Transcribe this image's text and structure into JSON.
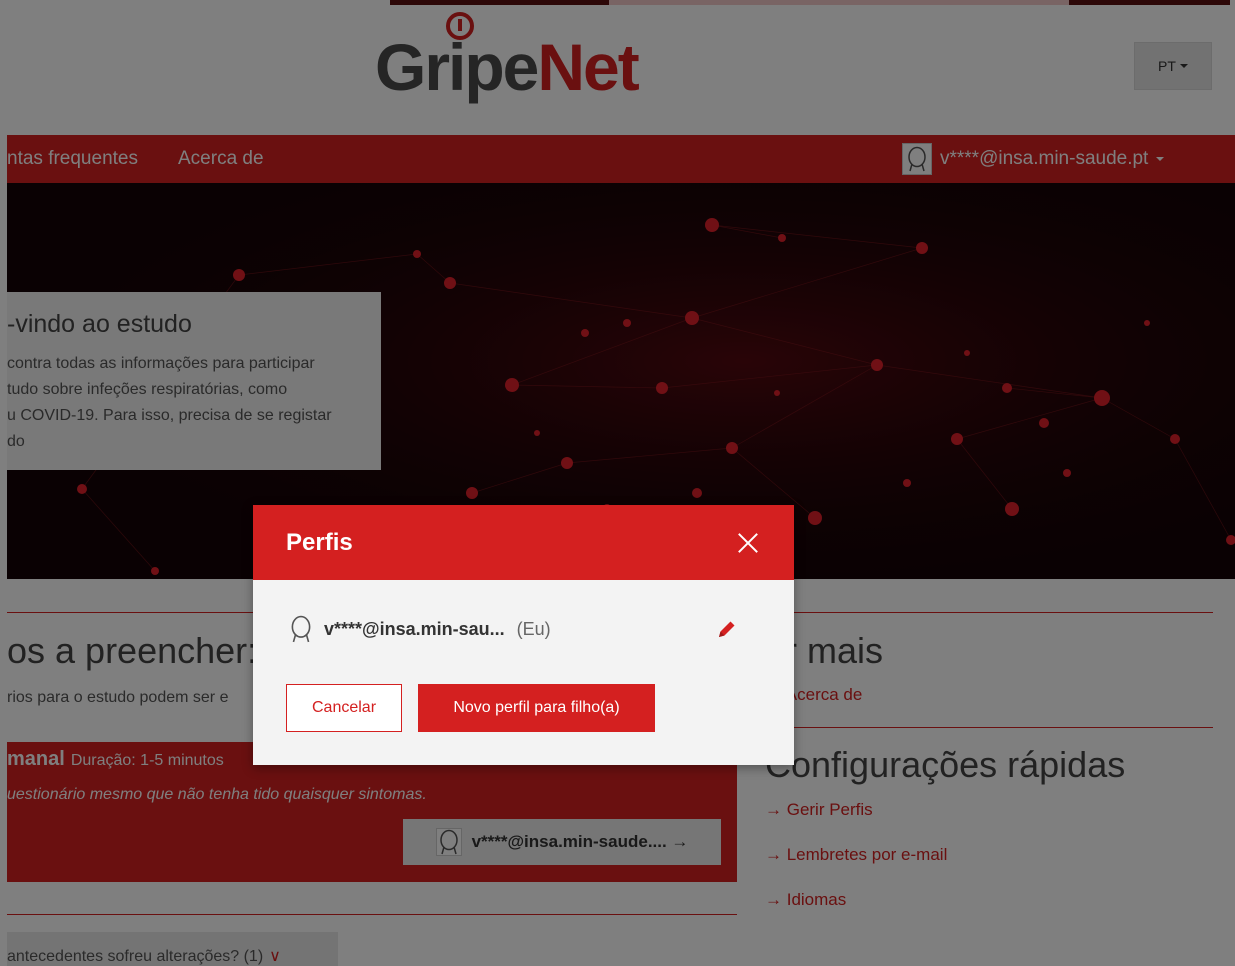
{
  "header": {
    "logo_part1": "Gri",
    "logo_part2": "pe",
    "logo_part3": "Net",
    "lang_label": "PT"
  },
  "nav": {
    "items": [
      {
        "label": "ntas frequentes"
      },
      {
        "label": "Acerca de"
      }
    ],
    "user_email": "v****@insa.min-saude.pt"
  },
  "hero": {
    "welcome_title": "-vindo ao estudo",
    "welcome_lines": [
      "contra todas as informações para participar",
      "tudo sobre infeções respiratórias, como",
      "u COVID-19. Para isso, precisa de se registar",
      "do"
    ]
  },
  "content": {
    "surveys_title": "os a preencher:",
    "surveys_text": "rios para o estudo podem ser e",
    "survey_title": "manal",
    "survey_duration": "Duração: 1-5 minutos",
    "survey_note": "uestionário mesmo que não tenha tido quaisquer sintomas.",
    "survey_button_label": "v****@insa.min-saude.... →",
    "learn_more_title": "er mais",
    "learn_more_link": "→ Acerca de",
    "quick_settings_title": "Configurações rápidas",
    "quick_links": [
      "→ Gerir Perfis",
      "→ Lembretes por e-mail",
      "→ Idiomas"
    ],
    "accordion_label": "antecedentes sofreu alterações? (1)",
    "accordion_chevron": "∨"
  },
  "modal": {
    "title": "Perfis",
    "profile_email": "v****@insa.min-sau...",
    "profile_tag": "(Eu)",
    "cancel_label": "Cancelar",
    "new_profile_label": "Novo perfil para filho(a)"
  },
  "colors": {
    "brand_red": "#d42020",
    "logo_gray": "#4a4a4a",
    "hero_bg": "#150306"
  },
  "icons": {
    "avatar": "avatar-icon",
    "close": "close-icon",
    "edit": "pencil-icon",
    "lang_caret": "caret-down-icon"
  }
}
